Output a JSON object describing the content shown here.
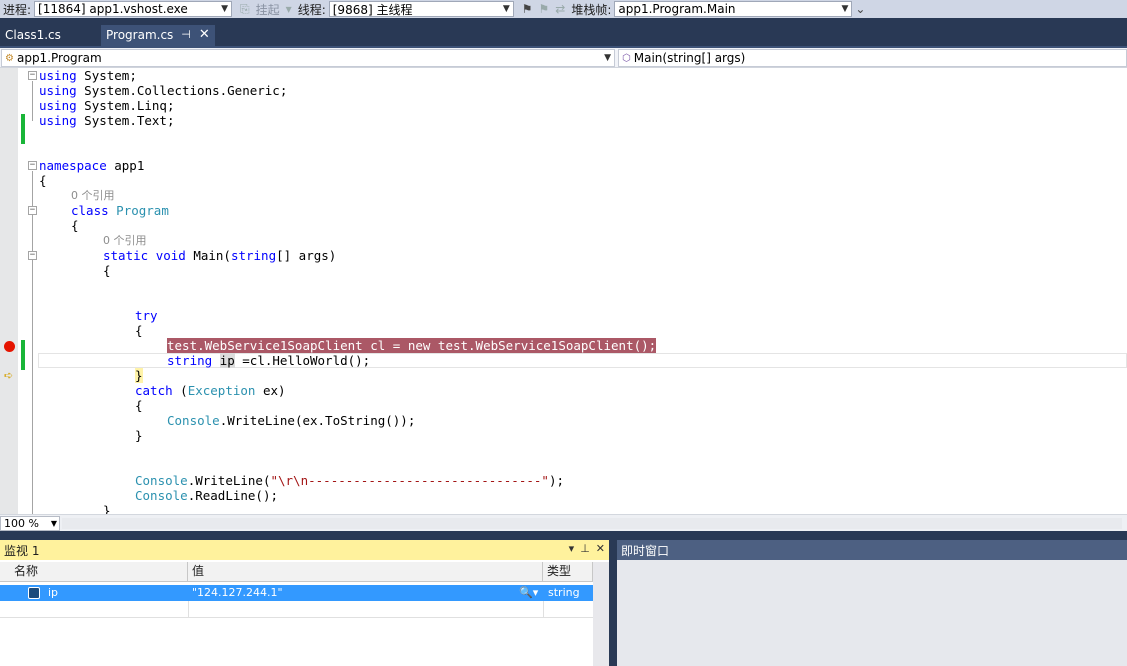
{
  "debugbar": {
    "process_label": "进程:",
    "process_value": "[11864] app1.vshost.exe",
    "suspend_label": "挂起",
    "thread_label": "线程:",
    "thread_value": "[9868] 主线程",
    "stack_label": "堆栈帧:",
    "stack_value": "app1.Program.Main"
  },
  "tabs": [
    {
      "label": "Class1.cs"
    },
    {
      "label": "Program.cs",
      "pin": "ᵖ",
      "close": "✕"
    }
  ],
  "navbar": {
    "type_value": "app1.Program",
    "member_value": "Main(string[] args)"
  },
  "code": {
    "l1_kw": "using",
    "l1_rest": " System;",
    "l2_kw": "using",
    "l2_rest": " System.Collections.Generic;",
    "l3_kw": "using",
    "l3_rest": " System.Linq;",
    "l4_kw": "using",
    "l4_rest": " System.Text;",
    "l5_kw": "namespace",
    "l5_rest": " app1",
    "brace_open": "{",
    "brace_close": "}",
    "lens_refs": "0 个引用",
    "class_kw": "class",
    "class_name": "Program",
    "static_kw": "static",
    "void_kw": "void",
    "main_name": " Main(",
    "string_kw": "string",
    "main_args": "[] args)",
    "try_kw": "try",
    "bp_line": "test.WebService1SoapClient cl = new test.WebService1SoapClient();",
    "string_kw2": "string",
    "ip_var": "ip",
    "ip_rest": " =cl.HelloWorld();",
    "catch_kw": "catch",
    "catch_paren": " (",
    "exception_type": "Exception",
    "catch_rest": " ex)",
    "console_type": "Console",
    "writeline_ex": ".WriteLine(ex.ToString());",
    "writeline_open": ".WriteLine(",
    "writeline_str": "\"\\r\\n-------------------------------\"",
    "writeline_close": ");",
    "readline": ".ReadLine();"
  },
  "zoom": {
    "value": "100 %"
  },
  "watch": {
    "title": "监视 1",
    "col_name": "名称",
    "col_value": "值",
    "col_type": "类型",
    "rows": [
      {
        "name": "ip",
        "value": "\"124.127.244.1\"",
        "type": "string"
      }
    ]
  },
  "immediate": {
    "title": "即时窗口"
  },
  "colors": {
    "accent": "#293955",
    "breakpoint_highlight": "#ab5866",
    "watch_header": "#fff29d",
    "selection": "#3399ff"
  }
}
